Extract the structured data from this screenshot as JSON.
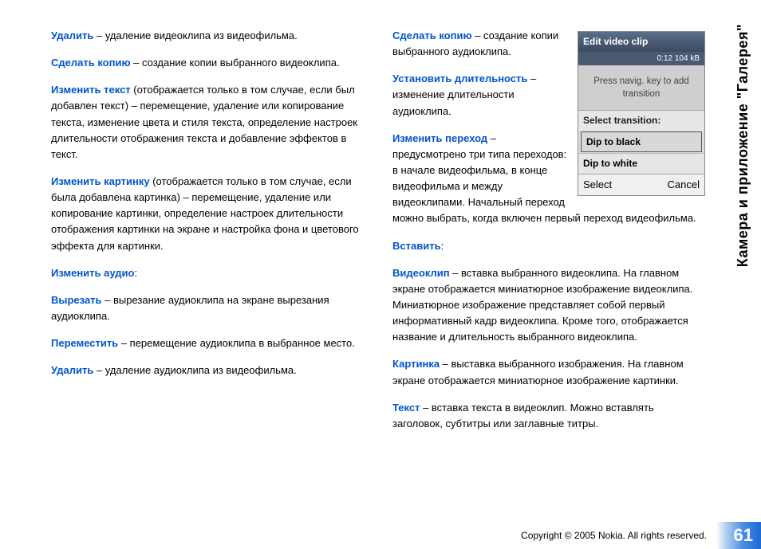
{
  "sideTab": "Камера и приложение \"Галерея\"",
  "left": {
    "p1": {
      "b": "Удалить",
      "t": " –  удаление видеоклипа из видеофильма."
    },
    "p2": {
      "b": "Сделать копию",
      "t": " –  создание копии выбранного видеоклипа."
    },
    "p3": {
      "b": "Изменить текст",
      "t": " (отображается только в том случае, если был добавлен текст) –  перемещение, удаление или копирование текста, изменение цвета и стиля текста, определение настроек длительности отображения текста и добавление эффектов в текст."
    },
    "p4": {
      "b": "Изменить картинку",
      "t": " (отображается только в том случае, если была добавлена картинка) –  перемещение, удаление или копирование картинки, определение настроек длительности отображения картинки на экране и настройка фона и цветового эффекта для картинки."
    },
    "p5": {
      "b": "Изменить аудио",
      "t": ":"
    },
    "p6": {
      "b": "Вырезать",
      "t": " –  вырезание аудиоклипа на экране вырезания аудиоклипа."
    },
    "p7": {
      "b": "Переместить",
      "t": " –  перемещение аудиоклипа в выбранное место."
    },
    "p8": {
      "b": "Удалить",
      "t": " –  удаление аудиоклипа из видеофильма."
    }
  },
  "right": {
    "p1": {
      "b": "Сделать копию",
      "t": " –  создание копии выбранного аудиоклипа."
    },
    "p2": {
      "b": "Установить длительность",
      "t": " –  изменение длительности аудиоклипа."
    },
    "p3": {
      "b": "Изменить переход",
      "t": " –  предусмотрено три типа переходов: в начале видеофильма, в конце видеофильма и между видеоклипами. Начальный переход можно выбрать, когда включен первый переход видеофильма."
    },
    "p4": {
      "b": "Вставить",
      "t": ":"
    },
    "p5": {
      "b": "Видеоклип",
      "t": " –  вставка выбранного видеоклипа. На главном экране отображается миниатюрное изображение видеоклипа. Миниатюрное изображение представляет собой первый информативный кадр видеоклипа. Кроме того, отображается название и длительность выбранного видеоклипа."
    },
    "p6": {
      "b": "Картинка",
      "t": " –  выставка выбранного изображения. На главном экране отображается миниатюрное изображение картинки."
    },
    "p7": {
      "b": "Текст",
      "t": " –  вставка текста в видеоклип. Можно вставлять заголовок, субтитры или заглавные титры."
    }
  },
  "phone": {
    "title": "Edit video clip",
    "status": "0:12  104 kB",
    "hint": "Press navig. key to add transition",
    "selectLabel": "Select transition:",
    "opt1": "Dip to black",
    "opt2": "Dip to white",
    "softLeft": "Select",
    "softRight": "Cancel"
  },
  "copyright": "Copyright © 2005 Nokia. All rights reserved.",
  "pageNumber": "61"
}
